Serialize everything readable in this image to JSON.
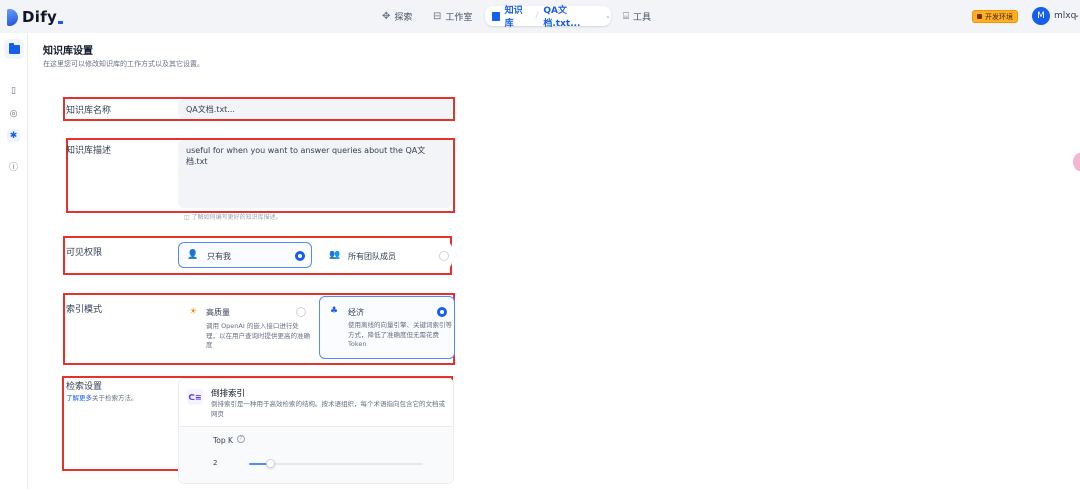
{
  "app": {
    "name": "Dify"
  },
  "nav": {
    "explore": "探索",
    "studio": "工作室",
    "knowledge": "知识库",
    "current_dataset": "QA文档.txt...",
    "tools": "工具"
  },
  "header": {
    "env_badge": "开发环境",
    "avatar_initial": "M",
    "username": "mlxq"
  },
  "page": {
    "title": "知识库设置",
    "subtitle": "在这里您可以修改知识库的工作方式以及其它设置。"
  },
  "form": {
    "name": {
      "label": "知识库名称",
      "value": "QA文档.txt..."
    },
    "description": {
      "label": "知识库描述",
      "value": "useful for when you want to answer queries about the QA文档.txt",
      "hint": "了解如何编写更好的知识库描述。"
    },
    "permission": {
      "label": "可见权限",
      "options": [
        {
          "label": "只有我",
          "selected": true
        },
        {
          "label": "所有团队成员",
          "selected": false
        }
      ]
    },
    "index_mode": {
      "label": "索引模式",
      "options": [
        {
          "title": "高质量",
          "desc": "调用 OpenAI 的嵌入接口进行处理，以在用户查询时提供更高的准确度",
          "selected": false
        },
        {
          "title": "经济",
          "desc": "使用离线的向量引擎、关键词索引等方式，降低了准确度但无需花费 Token",
          "selected": true
        }
      ]
    },
    "retrieval": {
      "label": "检索设置",
      "learn_more": "了解更多",
      "learn_suffix": "关于检索方法。",
      "method_title": "倒排索引",
      "method_desc": "倒排索引是一种用于高效检索的结构。按术语组织，每个术语指向包含它的文档或网页",
      "top_k_label": "Top K",
      "top_k_value": "2",
      "top_k_fraction": 0.12
    }
  },
  "colors": {
    "accent": "#155eef",
    "annotation": "#e5322d",
    "env_badge": "#fdb022"
  }
}
